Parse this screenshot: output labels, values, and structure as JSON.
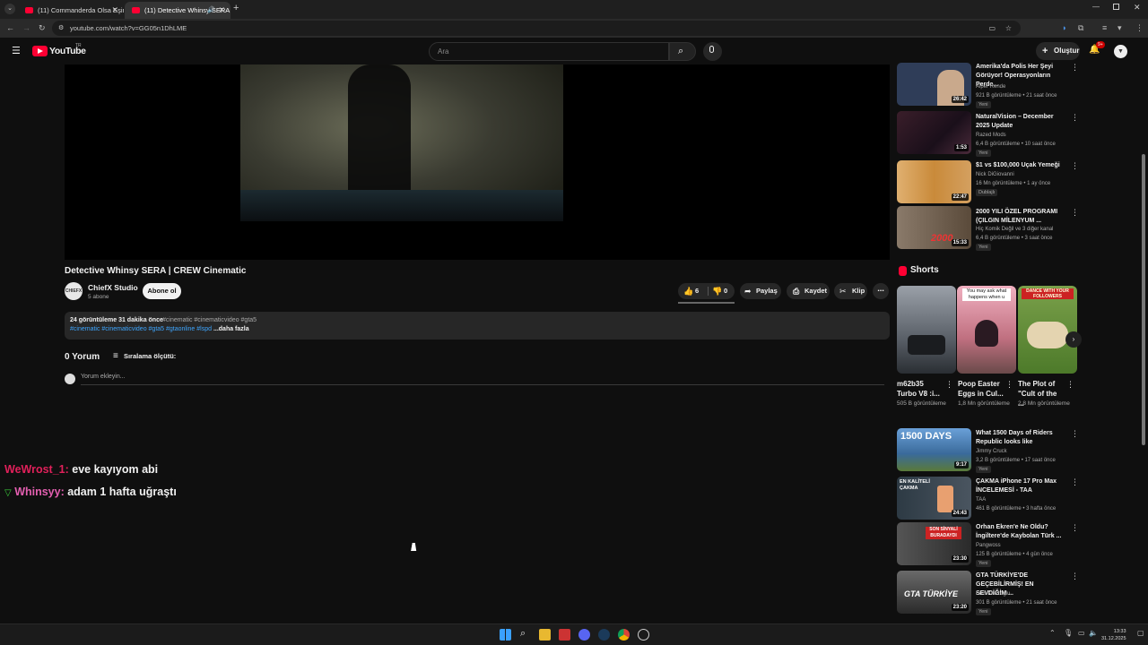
{
  "browser": {
    "tabs": [
      {
        "title": "(11) Commanderda Olsa Eşinin",
        "active": false
      },
      {
        "title": "(11) Detective Whinsy SERA",
        "active": true
      }
    ],
    "url": "youtube.com/watch?v=GG05n1DhLME"
  },
  "youtube": {
    "logo_text": "YouTube",
    "logo_region": "TR",
    "search_placeholder": "Ara",
    "create_label": "Oluştur",
    "notif_count": "9+"
  },
  "video": {
    "title": "Detective Whinsy SERA | CREW Cinematic",
    "channel": "ChiefX Studio",
    "channel_avatar_text": "CHIEFX",
    "subscribers": "5 abone",
    "subscribe_label": "Abone ol",
    "likes": "6",
    "dislikes": "0",
    "share_label": "Paylaş",
    "save_label": "Kaydet",
    "clip_label": "Klip",
    "description": {
      "stats": "24 görüntüleme  31 dakika önce",
      "tags_line1": "#cinematic #cinematicvideo #gta5",
      "tags_line2": "#cinematic #cinematicvideo #gta5 #gtaonline #lspd",
      "more": " ...daha fazla"
    },
    "comments_count": "0 Yorum",
    "sort_label": "Sıralama ölçütü:",
    "comment_placeholder": "Yorum ekleyin..."
  },
  "chat_overlay": [
    {
      "user": "WeWrost_1:",
      "message": " eve kayıyom abi",
      "user_color": "#e0205a"
    },
    {
      "user": "Whinsyy:",
      "message": " adam 1 hafta uğraştı",
      "user_color": "#e35fb0",
      "badge_color": "#3bd23b"
    }
  ],
  "sidebar": {
    "recommendations_top": [
      {
        "title": "Amerika'da Polis Her Şeyi Görüyor! Operasyonların Perde...",
        "channel": "Alper Rende",
        "meta": "921 B görüntüleme • 21 saat önce",
        "badge": "Yeni",
        "duration": "26:42",
        "thumb_color": "#2f3d58"
      },
      {
        "title": "NaturalVision – December 2025 Update",
        "channel": "Razed Mods",
        "meta": "6,4 B görüntüleme • 10 saat önce",
        "badge": "Yeni",
        "duration": "1:53",
        "thumb_color": "#3a1e2a"
      },
      {
        "title": "$1 vs $100,000 Uçak Yemeği",
        "channel": "Nick DiGiovanni",
        "meta": "16 Mn görüntüleme • 1 ay önce",
        "badge": "Dublajlı",
        "duration": "22:47",
        "thumb_color": "#c98a3a"
      },
      {
        "title": "2000 YILI ÖZEL PROGRAMI (ÇILGIN MİLENYUM ...",
        "channel": "Hiç Komik Değil ve 3 diğer kanal",
        "meta": "6,4 B görüntüleme • 3 saat önce",
        "badge": "Yeni",
        "duration": "15:33",
        "thumb_color": "#6a5a4a"
      }
    ],
    "shorts_title": "Shorts",
    "shorts": [
      {
        "title": "m62b35 Turbo V8 :i...",
        "views": "505 B görüntüleme",
        "thumb_color": "#8a9098"
      },
      {
        "title": "Poop Easter Eggs in Cul...",
        "views": "1,8 Mn görüntüleme",
        "thumb_color": "#b56a6a"
      },
      {
        "title": "The Plot of \"Cult of the ...",
        "views": "2,8 Mn görüntüleme",
        "thumb_color": "#5d8a3a"
      }
    ],
    "shorts_overlay": [
      "You may ask what happens when u",
      "DANCE WITH YOUR FOLLOWERS"
    ],
    "recommendations_bottom": [
      {
        "title": "What 1500 Days of Riders Republic looks like",
        "channel": "Jimmy Cruck",
        "meta": "3,2 B görüntüleme • 17 saat önce",
        "badge": "Yeni",
        "duration": "9:17",
        "thumb_color": "#4a7ab0",
        "thumb_text": "1500 DAYS"
      },
      {
        "title": "ÇAKMA iPhone 17 Pro Max İNCELEMESİ - TAA",
        "channel": "TAA",
        "meta": "461 B görüntüleme • 3 hafta önce",
        "badge": "",
        "duration": "24:43",
        "thumb_color": "#2d3a44",
        "thumb_text": "EN KALİTELİ ÇAKMA"
      },
      {
        "title": "Orhan Ekren'e Ne Oldu? İngiltere'de Kaybolan Türk ...",
        "channel": "Pangwoss",
        "meta": "125 B görüntüleme • 4 gün önce",
        "badge": "Yeni",
        "duration": "23:30",
        "thumb_color": "#3c3c3c",
        "thumb_text": "SON SİNYALİ BURADAYDI"
      },
      {
        "title": "GTA TÜRKİYE'DE GEÇEBİLİRMİŞ! EN SEVDİĞİM ...",
        "channel": "Enis Kirazoglu",
        "meta": "301 B görüntüleme • 21 saat önce",
        "badge": "Yeni",
        "duration": "23:20",
        "thumb_color": "#4a4a4a",
        "thumb_text": "GTA TÜRKİYE"
      }
    ]
  },
  "taskbar": {
    "time": "13:33",
    "date": "31.12.2025"
  }
}
